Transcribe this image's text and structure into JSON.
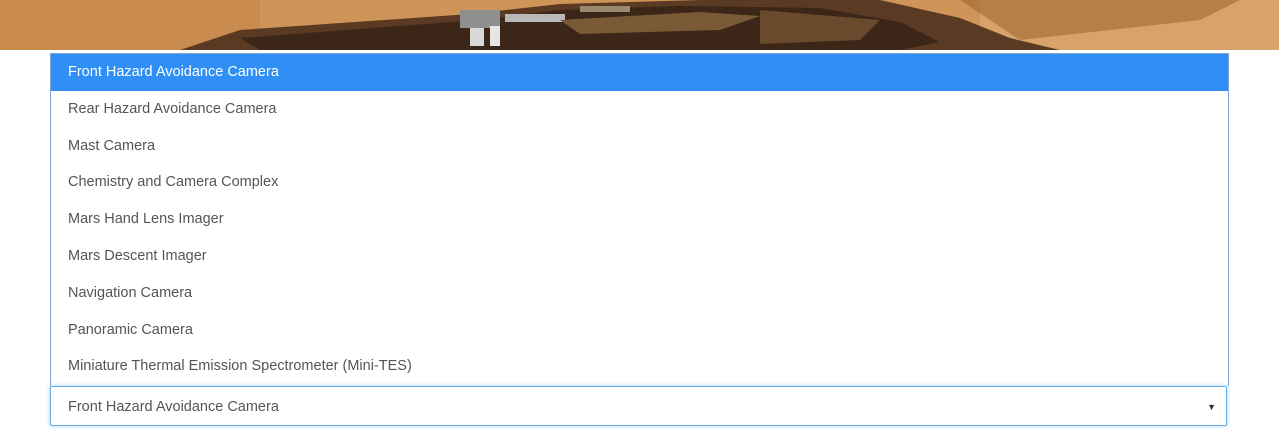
{
  "banner": {
    "description_icon": "mars-rover-banner-image"
  },
  "camera_select": {
    "selected_value": "Front Hazard Avoidance Camera",
    "arrow_icon": "caret-down-icon",
    "arrow_glyph": "▼",
    "options": [
      {
        "label": "Front Hazard Avoidance Camera",
        "selected": true
      },
      {
        "label": "Rear Hazard Avoidance Camera",
        "selected": false
      },
      {
        "label": "Mast Camera",
        "selected": false
      },
      {
        "label": "Chemistry and Camera Complex",
        "selected": false
      },
      {
        "label": "Mars Hand Lens Imager",
        "selected": false
      },
      {
        "label": "Mars Descent Imager",
        "selected": false
      },
      {
        "label": "Navigation Camera",
        "selected": false
      },
      {
        "label": "Panoramic Camera",
        "selected": false
      },
      {
        "label": "Miniature Thermal Emission Spectrometer (Mini-TES)",
        "selected": false
      }
    ]
  },
  "colors": {
    "highlight": "#2f8ff5",
    "focus_border": "#66afe9",
    "text": "#555555"
  }
}
